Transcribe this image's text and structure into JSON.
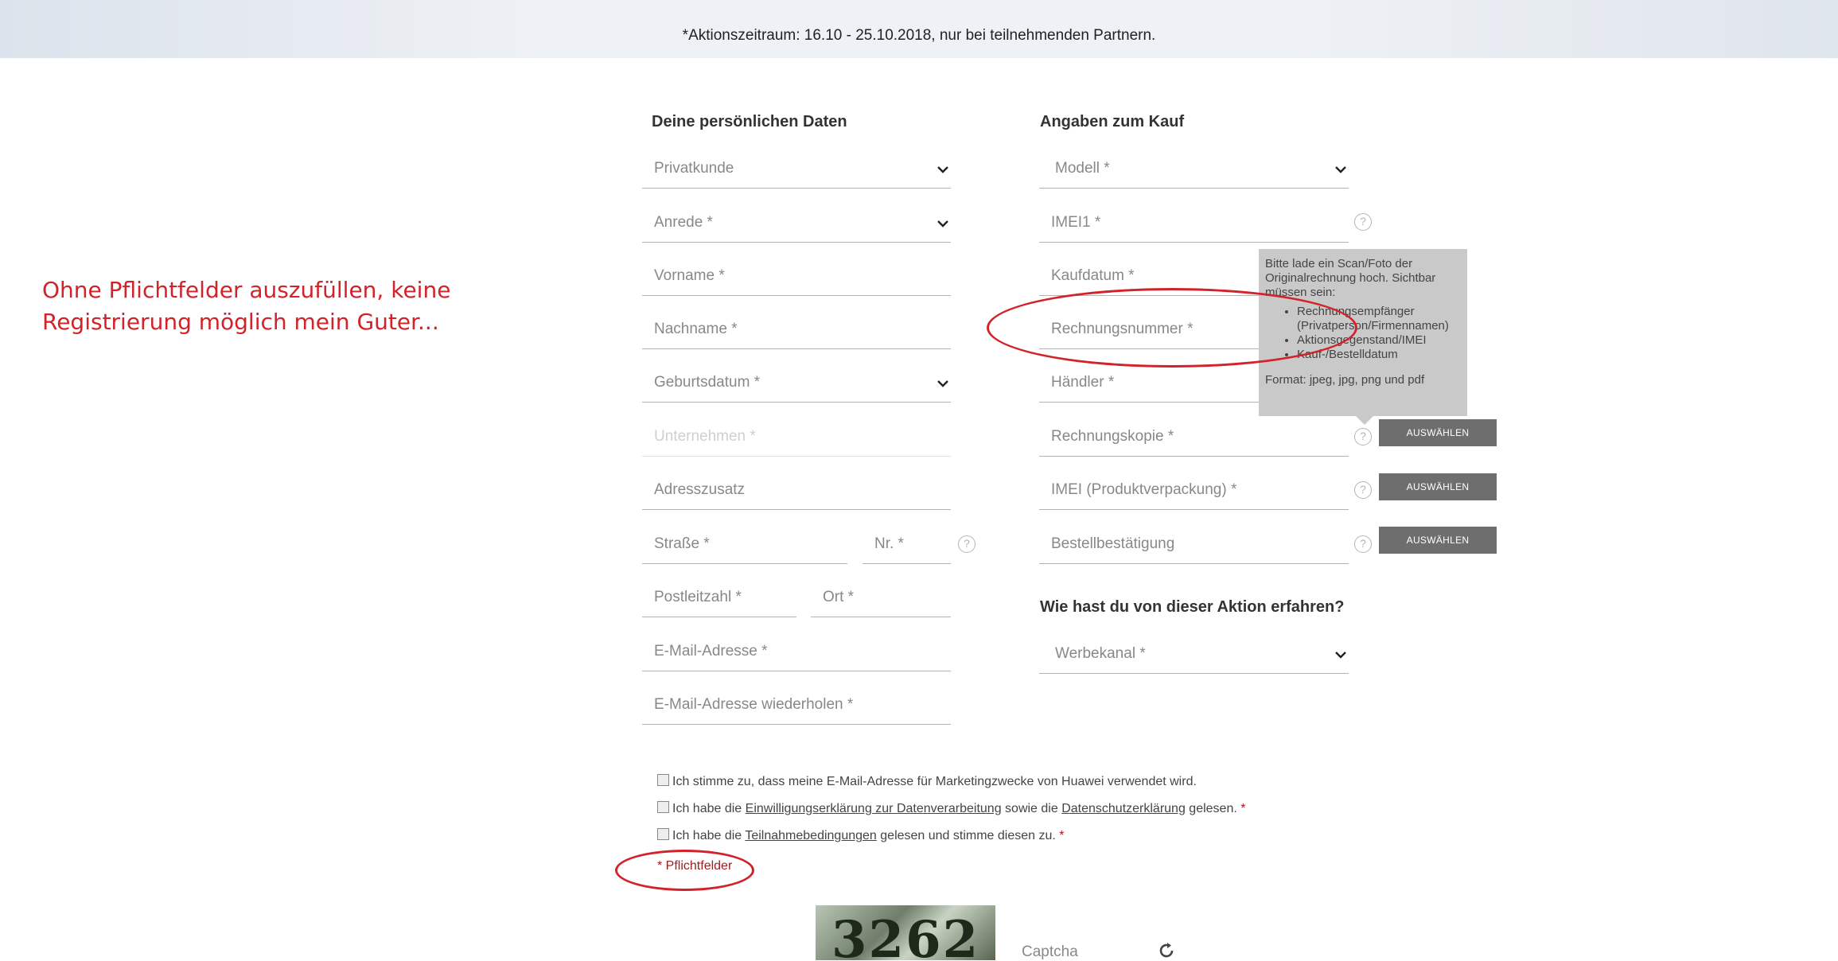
{
  "banner": {
    "text": "*Aktionszeitraum: 16.10 - 25.10.2018, nur bei teilnehmenden Partnern."
  },
  "annotation": {
    "text": "Ohne Pflichtfelder auszufüllen, keine Registrierung möglich mein Guter..."
  },
  "personal": {
    "title": "Deine persönlichen Daten",
    "customer_type": "Privatkunde",
    "salutation": "Anrede *",
    "first_name": "Vorname *",
    "last_name": "Nachname *",
    "birthdate": "Geburtsdatum *",
    "company": "Unternehmen *",
    "address_extra": "Adresszusatz",
    "street": "Straße *",
    "house_no": "Nr. *",
    "zip": "Postleitzahl *",
    "city": "Ort *",
    "email": "E-Mail-Adresse *",
    "email_repeat": "E-Mail-Adresse wiederholen *"
  },
  "purchase": {
    "title": "Angaben zum Kauf",
    "model": "Modell *",
    "imei1": "IMEI1 *",
    "purchase_date": "Kaufdatum *",
    "invoice_number": "Rechnungsnummer *",
    "dealer": "Händler *",
    "invoice_copy": "Rechnungskopie *",
    "imei_packaging": "IMEI (Produktverpackung) *",
    "order_confirmation": "Bestellbestätigung",
    "select_label": "AUSWÄHLEN"
  },
  "source": {
    "title": "Wie hast du von dieser Aktion erfahren?",
    "channel": "Werbekanal *"
  },
  "tooltip": {
    "intro": "Bitte lade ein Scan/Foto der Originalrechnung hoch. Sichtbar müssen sein:",
    "items": [
      "Rechnungsempfänger (Privatperson/Firmennamen)",
      "Aktionsgegenstand/IMEI",
      "Kauf-/Bestelldatum"
    ],
    "format": "Format: jpeg, jpg, png und pdf"
  },
  "consents": {
    "marketing": "Ich stimme zu, dass meine E-Mail-Adresse für Marketingzwecke von Huawei verwendet wird.",
    "privacy_pre": "Ich habe die",
    "privacy_link1": "Einwilligungserklärung zur Datenverarbeitung",
    "privacy_mid": "sowie die",
    "privacy_link2": "Datenschutzerklärung",
    "privacy_post": "gelesen.",
    "terms_pre": "Ich habe die",
    "terms_link": "Teilnahmebedingungen",
    "terms_post": "gelesen und stimme diesen zu.",
    "star": "*",
    "required_note": "* Pflichtfelder"
  },
  "captcha": {
    "code": "3262",
    "label": "Captcha"
  },
  "colors": {
    "accent_red": "#d2232a",
    "button_gray": "#6e6e6e"
  }
}
